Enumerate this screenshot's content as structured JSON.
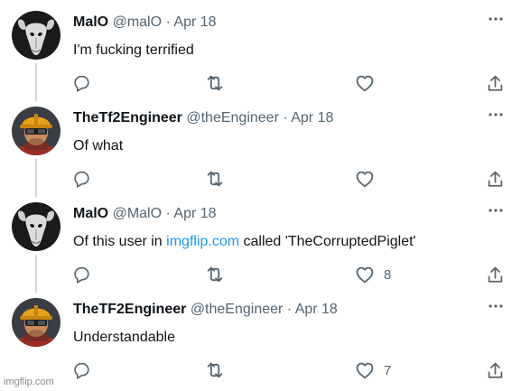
{
  "colors": {
    "text_primary": "#0f1419",
    "text_secondary": "#536471",
    "link": "#1d9bf0",
    "thread_line": "#cfd9de"
  },
  "tweets": [
    {
      "avatar": "goat-skull-avatar",
      "name": "MalO",
      "handle": "@malO",
      "separator": "·",
      "date": "Apr 18",
      "text_before": "I'm fucking terrified",
      "link": "",
      "text_after": "",
      "like_count": ""
    },
    {
      "avatar": "engineer-avatar",
      "name": "TheTf2Engineer",
      "handle": "@theEngineer",
      "separator": "·",
      "date": "Apr 18",
      "text_before": "Of what",
      "link": "",
      "text_after": "",
      "like_count": ""
    },
    {
      "avatar": "goat-skull-avatar",
      "name": "MalO",
      "handle": "@MalO",
      "separator": "·",
      "date": "Apr 18",
      "text_before": "Of this user in ",
      "link": "imgflip.com",
      "text_after": " called 'TheCorruptedPiglet'",
      "like_count": "8"
    },
    {
      "avatar": "engineer-avatar",
      "name": "TheTF2Engineer",
      "handle": "@theEngineer",
      "separator": "·",
      "date": "Apr 18",
      "text_before": "Understandable",
      "link": "",
      "text_after": "",
      "like_count": "7"
    }
  ],
  "watermark": "imgflip.com",
  "icons": {
    "reply": "reply-icon",
    "retweet": "retweet-icon",
    "like": "like-icon",
    "share": "share-icon",
    "more": "more-icon"
  }
}
